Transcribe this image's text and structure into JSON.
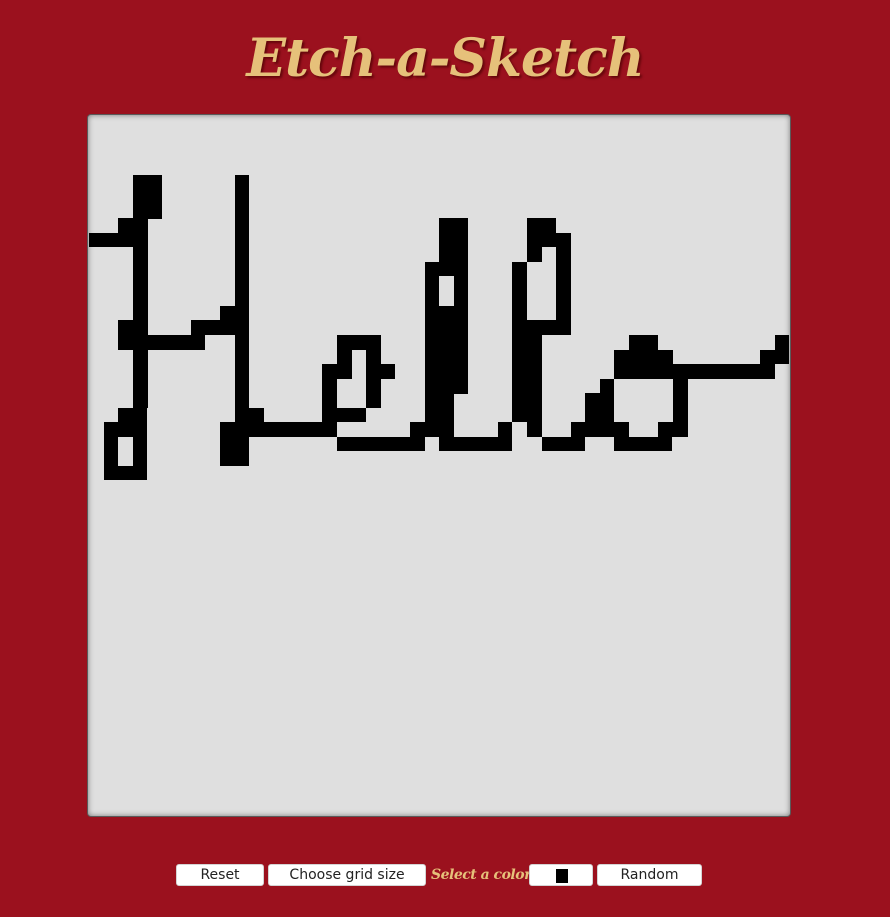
{
  "header": {
    "title": "Etch-a-Sketch"
  },
  "colors": {
    "background": "#9b111e",
    "title": "#e6c17a",
    "board": "#dfdfdf",
    "ink": "#000000"
  },
  "controls": {
    "reset_label": "Reset",
    "grid_size_label": "Choose grid size",
    "color_label": "Select a color:",
    "selected_color": "#000000",
    "random_label": "Random"
  }
}
